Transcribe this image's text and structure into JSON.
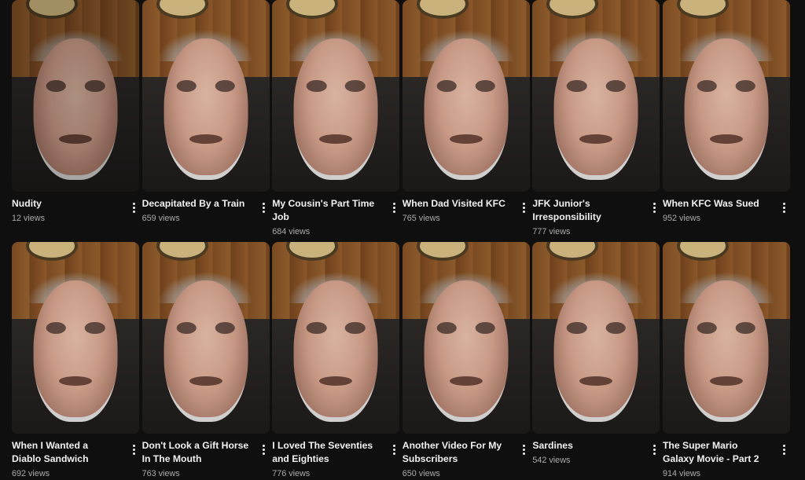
{
  "videos": [
    {
      "title": "Nudity",
      "views": "12 views"
    },
    {
      "title": "Decapitated By a Train",
      "views": "659 views"
    },
    {
      "title": "My Cousin's Part Time Job",
      "views": "684 views"
    },
    {
      "title": "When Dad Visited KFC",
      "views": "765 views"
    },
    {
      "title": "JFK Junior's Irresponsibility",
      "views": "777 views"
    },
    {
      "title": "When KFC Was Sued",
      "views": "952 views"
    },
    {
      "title": "When I Wanted a Diablo Sandwich",
      "views": "692 views"
    },
    {
      "title": "Don't Look a Gift Horse In The Mouth",
      "views": "763 views"
    },
    {
      "title": "I Loved The Seventies and Eighties",
      "views": "776 views"
    },
    {
      "title": "Another Video For My Subscribers",
      "views": "650 views"
    },
    {
      "title": "Sardines",
      "views": "542 views"
    },
    {
      "title": "The Super Mario Galaxy Movie - Part 2",
      "views": "914 views"
    }
  ],
  "icons": {
    "menu": "more-vertical-icon"
  },
  "colors": {
    "background": "#0f0f0f",
    "title": "#f1f1f1",
    "meta": "#aaaaaa"
  }
}
